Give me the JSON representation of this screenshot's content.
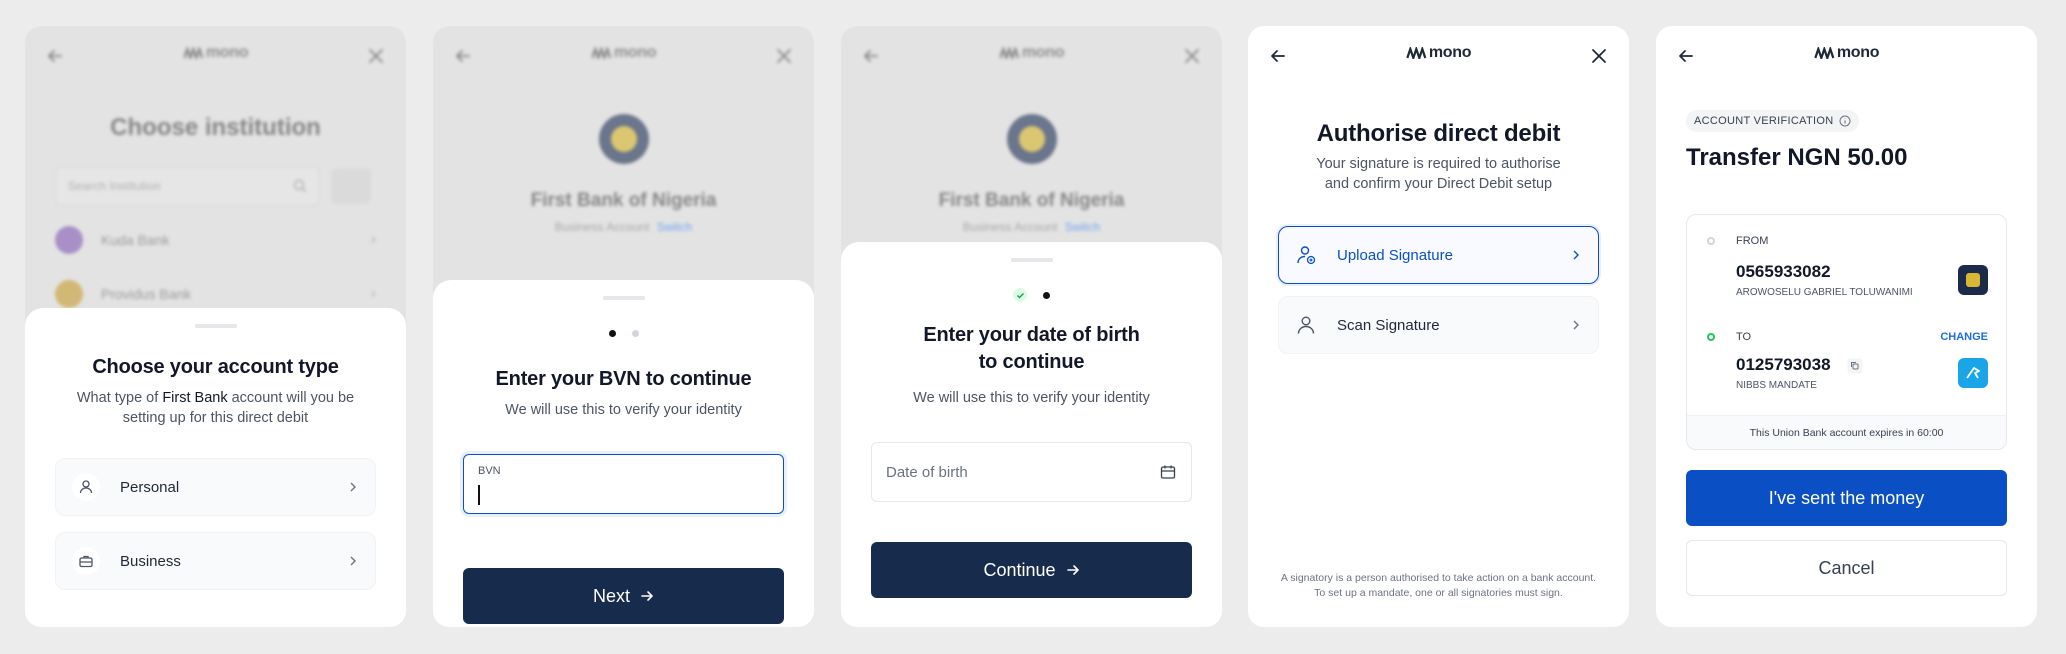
{
  "brand": {
    "name": "mono"
  },
  "panel1": {
    "bg": {
      "title": "Choose institution",
      "search_placeholder": "Search Institution",
      "banks": [
        "Kuda Bank",
        "Providus Bank"
      ]
    },
    "title": "Choose your account type",
    "subtitle_pre": "What type of ",
    "subtitle_bank": "First Bank",
    "subtitle_post": " account will you be setting up for this direct debit",
    "options": [
      {
        "label": "Personal",
        "icon": "person-icon"
      },
      {
        "label": "Business",
        "icon": "briefcase-icon"
      }
    ]
  },
  "panel2": {
    "bg": {
      "bank_name": "First Bank of Nigeria",
      "account_type": "Business Account",
      "switch": "Switch"
    },
    "title": "Enter your BVN to continue",
    "subtitle": "We will use this to verify your identity",
    "field_label": "BVN",
    "button": "Next"
  },
  "panel3": {
    "bg": {
      "bank_name": "First Bank of Nigeria",
      "account_type": "Business Account",
      "switch": "Switch"
    },
    "title_line1": "Enter your date of birth",
    "title_line2": "to continue",
    "subtitle": "We will use this to verify your identity",
    "field_placeholder": "Date of birth",
    "button": "Continue"
  },
  "panel4": {
    "title": "Authorise direct debit",
    "subtitle_line1": "Your signature is required to authorise",
    "subtitle_line2": "and confirm your Direct Debit setup",
    "options": [
      {
        "label": "Upload Signature",
        "icon": "upload-signature-icon"
      },
      {
        "label": "Scan Signature",
        "icon": "person-icon"
      }
    ],
    "footnote": "A signatory is a person authorised to take action on a bank account. To set up a mandate, one or all signatories must sign."
  },
  "panel5": {
    "badge": "ACCOUNT VERIFICATION",
    "title": "Transfer NGN 50.00",
    "from_label": "FROM",
    "from_account": "0565933082",
    "from_name": "AROWOSELU GABRIEL TOLUWANIMI",
    "to_label": "TO",
    "to_change": "CHANGE",
    "to_account": "0125793038",
    "to_name": "NIBBS MANDATE",
    "expiry": "This Union Bank account expires in 60:00",
    "primary_button": "I've sent the money",
    "secondary_button": "Cancel"
  },
  "colors": {
    "navy": "#172b4d",
    "blue": "#0b4fc4",
    "link_blue": "#1d6fe0",
    "green": "#22c55e"
  }
}
